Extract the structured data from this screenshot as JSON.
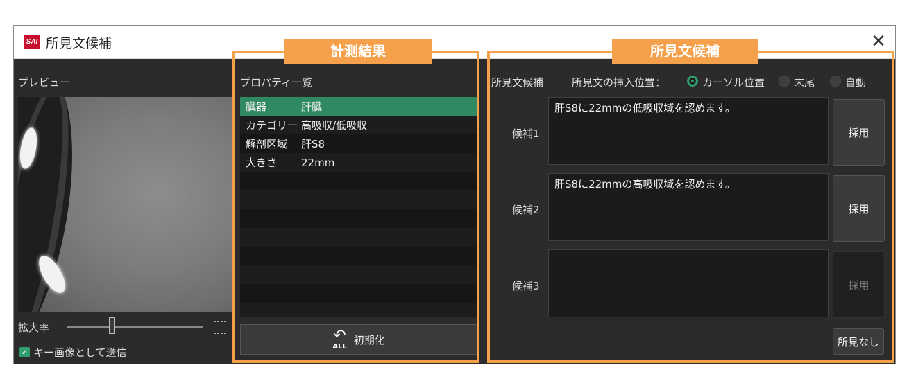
{
  "window": {
    "title": "所見文候補",
    "logo_text": "SAI",
    "close_glyph": "✕"
  },
  "preview": {
    "label": "プレビュー",
    "zoom_label": "拡大率",
    "zoom_level": 0.33,
    "send_checkbox_label": "キー画像として送信",
    "send_checked": true
  },
  "measurement": {
    "tab": "計測結果",
    "list_title": "プロパティ一覧",
    "properties": [
      {
        "key": "臓器",
        "value": "肝臓",
        "selected": true
      },
      {
        "key": "カテゴリー",
        "value": "高吸収/低吸収",
        "selected": false
      },
      {
        "key": "解剖区域",
        "value": "肝S8",
        "selected": false
      },
      {
        "key": "大きさ",
        "value": "22mm",
        "selected": false
      }
    ],
    "reset_icon_text": "ALL",
    "reset_label": "初期化"
  },
  "candidates": {
    "tab": "所見文候補",
    "header_label": "所見文候補",
    "insert_position_label": "所見文の挿入位置：",
    "options": [
      {
        "label": "カーソル位置",
        "selected": true
      },
      {
        "label": "末尾",
        "selected": false
      },
      {
        "label": "自動",
        "selected": false
      }
    ],
    "items": [
      {
        "label": "候補1",
        "text": "肝S8に22mmの低吸収域を認めます。",
        "button": "採用",
        "enabled": true
      },
      {
        "label": "候補2",
        "text": "肝S8に22mmの高吸収域を認めます。",
        "button": "採用",
        "enabled": true
      },
      {
        "label": "候補3",
        "text": "",
        "button": "採用",
        "enabled": false
      }
    ],
    "no_findings_button": "所見なし"
  },
  "colors": {
    "accent_orange": "#f5a04a",
    "selection_green": "#2f8a62",
    "panel_bg": "#2b2b2b"
  }
}
